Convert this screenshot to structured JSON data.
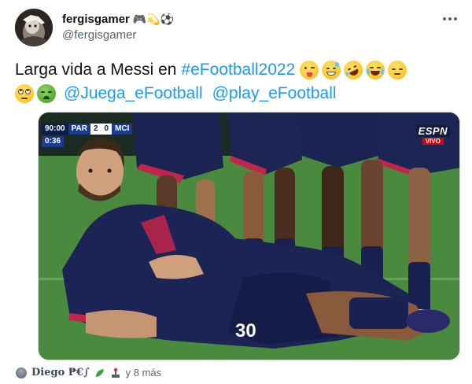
{
  "user": {
    "display_name": "fergisgamer",
    "name_emojis": "🎮💫⚽",
    "handle": "@fergisgamer",
    "avatar": "avatar-photo"
  },
  "tweet": {
    "text_prefix": "Larga vida a Messi en",
    "hashtag": "#eFootball2022",
    "mention_1": "@Juega_eFootball",
    "mention_2": "@play_eFootball",
    "emojis_line1": [
      "winking-tongue-emoji",
      "grinning-sweat-emoji",
      "rolling-laughing-emoji",
      "tears-of-joy-emoji",
      "disappointed-emoji"
    ],
    "emojis_line2": [
      "rolling-eyes-emoji",
      "nauseated-emoji"
    ]
  },
  "media": {
    "scoreboard": {
      "time": "90:00",
      "home": "PAR",
      "home_score": "2",
      "away_score": "0",
      "away": "MCI",
      "added": "0:36"
    },
    "broadcaster": "ESPN",
    "live_label": "VIVO",
    "shirt_number": "30"
  },
  "social_context": {
    "name": "Diego ₱€∫",
    "suffix": "y 8 más"
  },
  "colors": {
    "link": "#1d9bf0",
    "text": "#0f1419",
    "secondary": "#536471"
  }
}
